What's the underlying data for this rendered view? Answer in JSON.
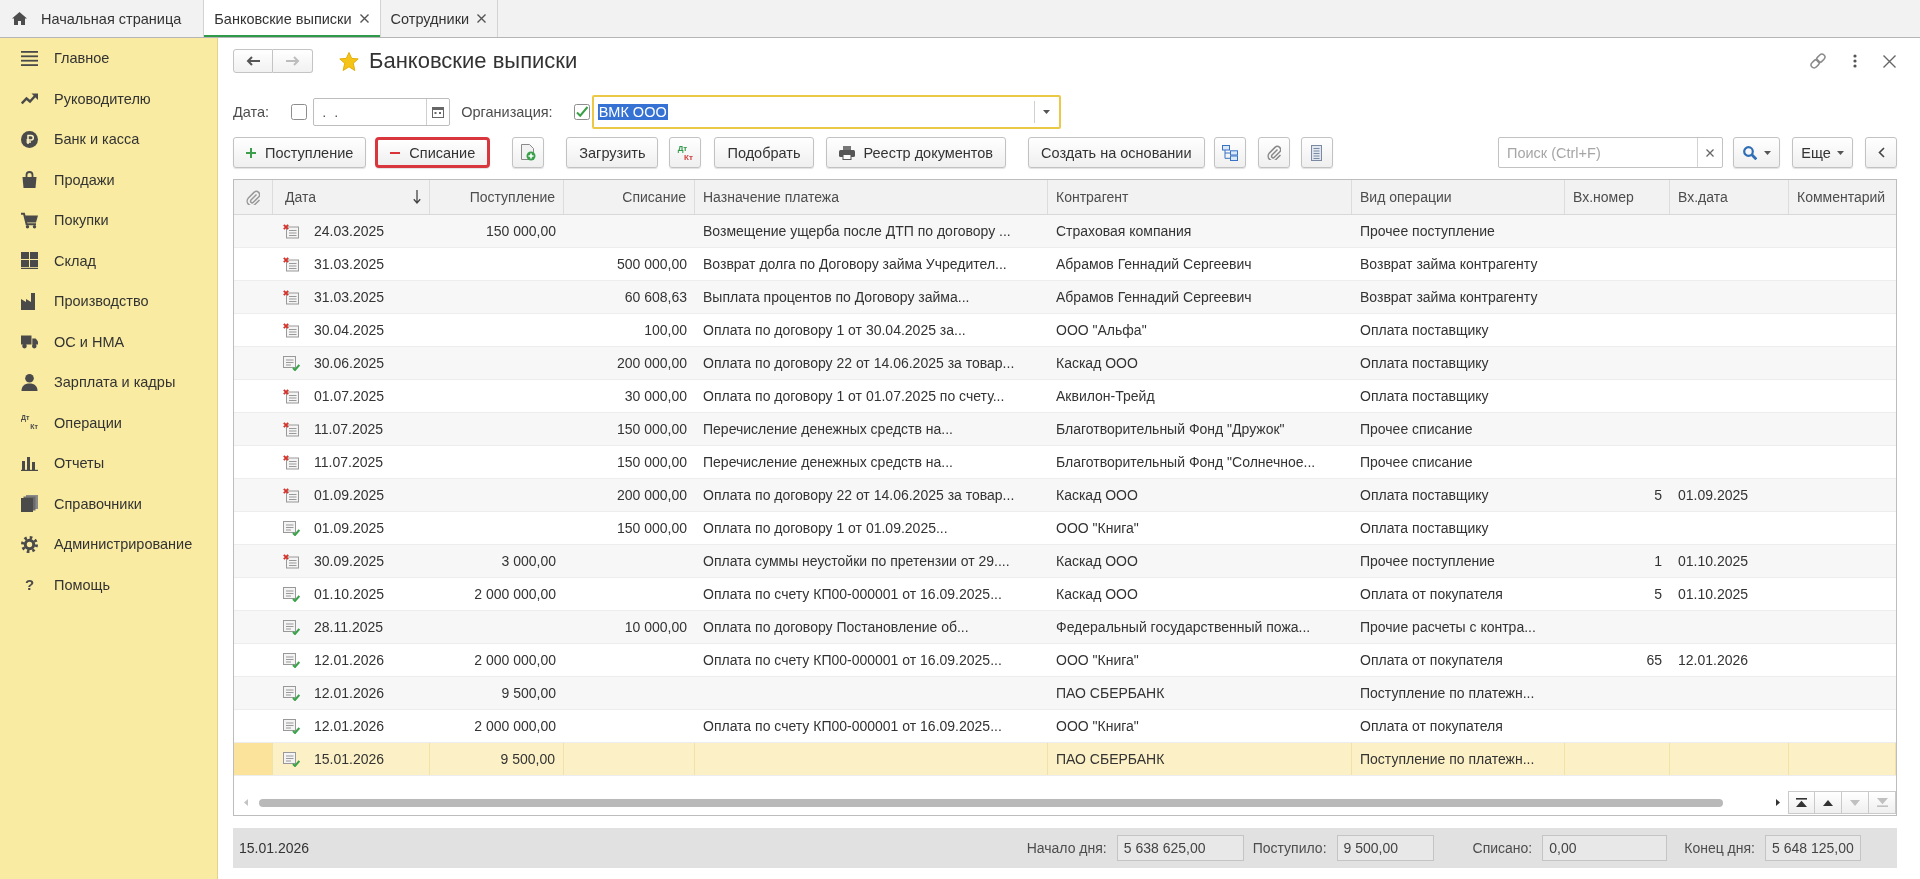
{
  "tabs": [
    {
      "kind": "home",
      "label": "Начальная страница",
      "selected": false
    },
    {
      "kind": "document",
      "label": "Банковские выписки",
      "selected": true
    },
    {
      "kind": "document",
      "label": "Сотрудники",
      "selected": false
    }
  ],
  "sidebar": {
    "items": [
      {
        "label": "Главное"
      },
      {
        "label": "Руководителю"
      },
      {
        "label": "Банк и касса"
      },
      {
        "label": "Продажи"
      },
      {
        "label": "Покупки"
      },
      {
        "label": "Склад"
      },
      {
        "label": "Производство"
      },
      {
        "label": "ОС и НМА"
      },
      {
        "label": "Зарплата и кадры"
      },
      {
        "label": "Операции",
        "icon_text": [
          "Дт",
          "Кт"
        ]
      },
      {
        "label": "Отчеты"
      },
      {
        "label": "Справочники"
      },
      {
        "label": "Администрирование"
      },
      {
        "label": "Помощь",
        "icon_text": [
          "?"
        ]
      }
    ]
  },
  "header": {
    "back_disabled": false,
    "forward_disabled": true,
    "favorite": true,
    "title": "Банковские выписки"
  },
  "filters": {
    "date": {
      "label": "Дата:",
      "checked": false,
      "value": ".  ."
    },
    "organization": {
      "label": "Организация:",
      "checked": true,
      "value": "ВМК ООО",
      "value_selected": true
    }
  },
  "toolbar": {
    "income_button": {
      "label": "Поступление",
      "highlighted": false
    },
    "expense_button": {
      "label": "Списание",
      "highlighted": true
    },
    "load_button": {
      "label": "Загрузить",
      "highlighted": false
    },
    "debit_credit_button": {
      "debit": "Дт",
      "credit": "Кт"
    },
    "select_button": {
      "label": "Подобрать",
      "highlighted": false
    },
    "register_button": {
      "label": "Реестр документов",
      "highlighted": false
    },
    "create_based_button": {
      "label": "Создать на основании",
      "highlighted": false
    },
    "search": {
      "placeholder": "Поиск (Ctrl+F)"
    },
    "more_button": {
      "label": "Еще",
      "highlighted": false
    }
  },
  "table": {
    "columns": [
      {
        "kind": "attachment",
        "sorted": false
      },
      {
        "kind": "text",
        "label": "Дата",
        "sorted": true
      },
      {
        "kind": "text",
        "label": "Поступление",
        "sorted": false
      },
      {
        "kind": "text",
        "label": "Списание",
        "sorted": false
      },
      {
        "kind": "text",
        "label": "Назначение платежа",
        "sorted": false
      },
      {
        "kind": "text",
        "label": "Контрагент",
        "sorted": false
      },
      {
        "kind": "text",
        "label": "Вид операции",
        "sorted": false
      },
      {
        "kind": "text",
        "label": "Вх.номер",
        "sorted": false
      },
      {
        "kind": "text",
        "label": "Вх.дата",
        "sorted": false
      },
      {
        "kind": "text",
        "label": "Комментарий",
        "sorted": false
      }
    ],
    "rows": [
      {
        "selected": false,
        "marked_for_deletion": true,
        "date": "24.03.2025",
        "income": "150 000,00",
        "purpose": "Возмещение ущерба после ДТП по договору ...",
        "counterparty": "Страховая компания",
        "operation": "Прочее поступление"
      },
      {
        "selected": false,
        "marked_for_deletion": true,
        "date": "31.03.2025",
        "expense": "500 000,00",
        "purpose": "Возврат долга по Договору займа Учредител...",
        "counterparty": "Абрамов Геннадий Сергеевич",
        "operation": "Возврат займа контрагенту"
      },
      {
        "selected": false,
        "marked_for_deletion": true,
        "date": "31.03.2025",
        "expense": "60 608,63",
        "purpose": "Выплата процентов по Договору займа...",
        "counterparty": "Абрамов Геннадий Сергеевич",
        "operation": "Возврат займа контрагенту"
      },
      {
        "selected": false,
        "marked_for_deletion": true,
        "date": "30.04.2025",
        "expense": "100,00",
        "purpose": "Оплата по договору 1 от 30.04.2025 за...",
        "counterparty": "ООО \"Альфа\"",
        "operation": "Оплата поставщику"
      },
      {
        "selected": false,
        "marked_for_deletion": false,
        "date": "30.06.2025",
        "expense": "200 000,00",
        "purpose": "Оплата по договору 22 от 14.06.2025 за товар...",
        "counterparty": "Каскад ООО",
        "operation": "Оплата поставщику"
      },
      {
        "selected": false,
        "marked_for_deletion": true,
        "date": "01.07.2025",
        "expense": "30 000,00",
        "purpose": "Оплата по договору 1 от 01.07.2025 по счету...",
        "counterparty": "Аквилон-Трейд",
        "operation": "Оплата поставщику"
      },
      {
        "selected": false,
        "marked_for_deletion": true,
        "date": "11.07.2025",
        "expense": "150 000,00",
        "purpose": "Перечисление денежных средств на...",
        "counterparty": "Благотворительный Фонд \"Дружок\"",
        "operation": "Прочее списание"
      },
      {
        "selected": false,
        "marked_for_deletion": true,
        "date": "11.07.2025",
        "expense": "150 000,00",
        "purpose": "Перечисление денежных средств на...",
        "counterparty": "Благотворительный Фонд \"Солнечное...",
        "operation": "Прочее списание"
      },
      {
        "selected": false,
        "marked_for_deletion": true,
        "date": "01.09.2025",
        "expense": "200 000,00",
        "purpose": "Оплата по договору 22 от 14.06.2025 за товар...",
        "counterparty": "Каскад ООО",
        "operation": "Оплата поставщику",
        "in_number": "5",
        "in_date": "01.09.2025"
      },
      {
        "selected": false,
        "marked_for_deletion": false,
        "date": "01.09.2025",
        "expense": "150 000,00",
        "purpose": "Оплата по договору 1 от 01.09.2025...",
        "counterparty": "ООО \"Книга\"",
        "operation": "Оплата поставщику"
      },
      {
        "selected": false,
        "marked_for_deletion": true,
        "date": "30.09.2025",
        "income": "3 000,00",
        "purpose": "Оплата суммы неустойки по претензии от 29....",
        "counterparty": "Каскад ООО",
        "operation": "Прочее поступление",
        "in_number": "1",
        "in_date": "01.10.2025"
      },
      {
        "selected": false,
        "marked_for_deletion": false,
        "date": "01.10.2025",
        "income": "2 000 000,00",
        "purpose": "Оплата по счету КП00-000001 от 16.09.2025...",
        "counterparty": "Каскад ООО",
        "operation": "Оплата от покупателя",
        "in_number": "5",
        "in_date": "01.10.2025"
      },
      {
        "selected": false,
        "marked_for_deletion": false,
        "date": "28.11.2025",
        "expense": "10 000,00",
        "purpose": "Оплата по договору Постановление об...",
        "counterparty": "Федеральный государственный пожа...",
        "operation": "Прочие расчеты с контра..."
      },
      {
        "selected": false,
        "marked_for_deletion": false,
        "date": "12.01.2026",
        "income": "2 000 000,00",
        "purpose": "Оплата по счету КП00-000001 от 16.09.2025...",
        "counterparty": "ООО \"Книга\"",
        "operation": "Оплата от покупателя",
        "in_number": "65",
        "in_date": "12.01.2026"
      },
      {
        "selected": false,
        "marked_for_deletion": false,
        "date": "12.01.2026",
        "income": "9 500,00",
        "counterparty": "ПАО СБЕРБАНК",
        "operation": "Поступление по платежн..."
      },
      {
        "selected": false,
        "marked_for_deletion": false,
        "date": "12.01.2026",
        "income": "2 000 000,00",
        "purpose": "Оплата по счету КП00-000001 от 16.09.2025...",
        "counterparty": "ООО \"Книга\"",
        "operation": "Оплата от покупателя"
      },
      {
        "selected": true,
        "marked_for_deletion": false,
        "date": "15.01.2026",
        "income": "9 500,00",
        "counterparty": "ПАО СБЕРБАНК",
        "operation": "Поступление по платежн..."
      }
    ],
    "nav_buttons": [
      {
        "kind": "first",
        "disabled": false
      },
      {
        "kind": "up",
        "disabled": false
      },
      {
        "kind": "down",
        "disabled": true
      },
      {
        "kind": "last",
        "disabled": true
      }
    ]
  },
  "footer": {
    "date": "15.01.2026",
    "totals": [
      {
        "label": "Начало дня:",
        "value": "5 638 625,00"
      },
      {
        "label": "Поступило:",
        "value": "9 500,00"
      },
      {
        "label": "Списано:",
        "value": "0,00"
      },
      {
        "label": "Конец дня:",
        "value": "5 648 125,00"
      }
    ]
  }
}
